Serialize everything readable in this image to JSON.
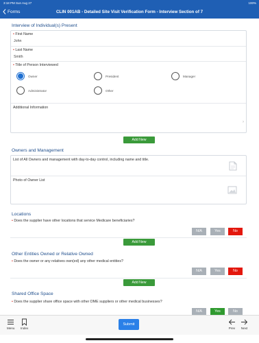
{
  "status": {
    "time": "3:18 PM",
    "date": "Sun Aug 27",
    "right": "100%"
  },
  "nav": {
    "back_label": "Forms",
    "title": "CLIN 001AB - Detailed Site Visit Verification Form - Interview Section of 7"
  },
  "interview": {
    "section_title": "Interview of Individual(s) Present",
    "first_name": {
      "label": "First Name",
      "value": "John"
    },
    "last_name": {
      "label": "Last Name",
      "value": "Smith"
    },
    "title_label": "Title of Person Interviewed",
    "options": [
      {
        "label": "Owner",
        "selected": true
      },
      {
        "label": "President",
        "selected": false
      },
      {
        "label": "Manager",
        "selected": false
      },
      {
        "label": "Administrator",
        "selected": false
      },
      {
        "label": "Other",
        "selected": false
      }
    ],
    "additional_label": "Additional Information",
    "add_new": "Add New"
  },
  "owners": {
    "section_title": "Owners and Management",
    "list_label": "List of All Owners and management with day-to-day control, including name and title.",
    "photo_label": "Photo of Owner List"
  },
  "locations": {
    "section_title": "Locations",
    "question": "Does the supplier have other locations that service Medicare beneficiaries?",
    "answer": "No",
    "add_new": "Add New"
  },
  "other_entities": {
    "section_title": "Other Entities Owned or Relative Owned",
    "question": "Does the owner or any relatives own(ed) any other medical entities?",
    "answer": "No",
    "add_new": "Add New"
  },
  "shared_office": {
    "section_title": "Shared Office Space",
    "question": "Does the supplier share office space with other DME suppliers or other medical businesses?",
    "answer": "Yes"
  },
  "buttons": {
    "na": "N/A",
    "yes": "Yes",
    "no": "No"
  },
  "toolbar": {
    "menu": "Menu",
    "index": "Index",
    "submit": "Submit",
    "prev": "Prev",
    "next": "Next"
  },
  "colors": {
    "brand": "#1f5fb4",
    "add_green": "#3a9a3a",
    "yes_green": "#2f9a2f",
    "no_red": "#e3170d",
    "disabled_gray": "#a9b0b7",
    "submit_blue": "#2a80e8"
  }
}
